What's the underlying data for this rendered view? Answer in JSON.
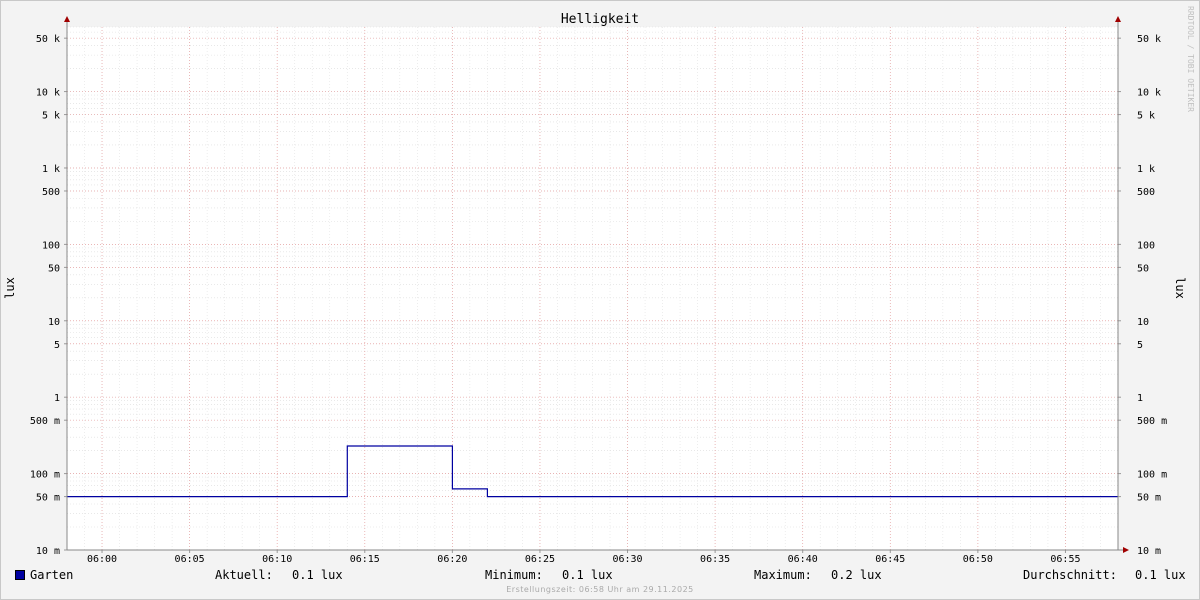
{
  "chart_data": {
    "type": "line",
    "title": "Helligkeit",
    "ylabel": "lux",
    "ylabel_right": "lux",
    "yscale": "log",
    "ylim": [
      0.01,
      70000
    ],
    "y_ticks": [
      {
        "value": 50000,
        "label": "50 k"
      },
      {
        "value": 10000,
        "label": "10 k"
      },
      {
        "value": 5000,
        "label": "5 k"
      },
      {
        "value": 1000,
        "label": "1 k"
      },
      {
        "value": 500,
        "label": "500"
      },
      {
        "value": 100,
        "label": "100"
      },
      {
        "value": 50,
        "label": "50"
      },
      {
        "value": 10,
        "label": "10"
      },
      {
        "value": 5,
        "label": "5"
      },
      {
        "value": 1,
        "label": "1"
      },
      {
        "value": 0.5,
        "label": "500 m"
      },
      {
        "value": 0.1,
        "label": "100 m"
      },
      {
        "value": 0.05,
        "label": "50 m"
      },
      {
        "value": 0.01,
        "label": "10 m"
      }
    ],
    "x_ticks": [
      "06:00",
      "06:05",
      "06:10",
      "06:15",
      "06:20",
      "06:25",
      "06:30",
      "06:35",
      "06:40",
      "06:45",
      "06:50",
      "06:55"
    ],
    "x_range": [
      "05:58",
      "06:58"
    ],
    "grid": true,
    "series": [
      {
        "name": "Garten",
        "color": "#0000a0",
        "x": [
          "05:58",
          "06:14",
          "06:14",
          "06:20",
          "06:20",
          "06:22",
          "06:22",
          "06:58"
        ],
        "values": [
          0.05,
          0.05,
          0.23,
          0.23,
          0.063,
          0.063,
          0.05,
          0.05
        ]
      }
    ]
  },
  "legend": {
    "series_name": "Garten",
    "current_label": "Aktuell:",
    "current_value": "0.1 lux",
    "min_label": "Minimum:",
    "min_value": "0.1 lux",
    "max_label": "Maximum:",
    "max_value": "0.2 lux",
    "avg_label": "Durchschnitt:",
    "avg_value": "0.1 lux"
  },
  "footer": "Erstellungszeit: 06:58 Uhr am 29.11.2025",
  "watermark": "RRDTOOL / TOBI OETIKER"
}
